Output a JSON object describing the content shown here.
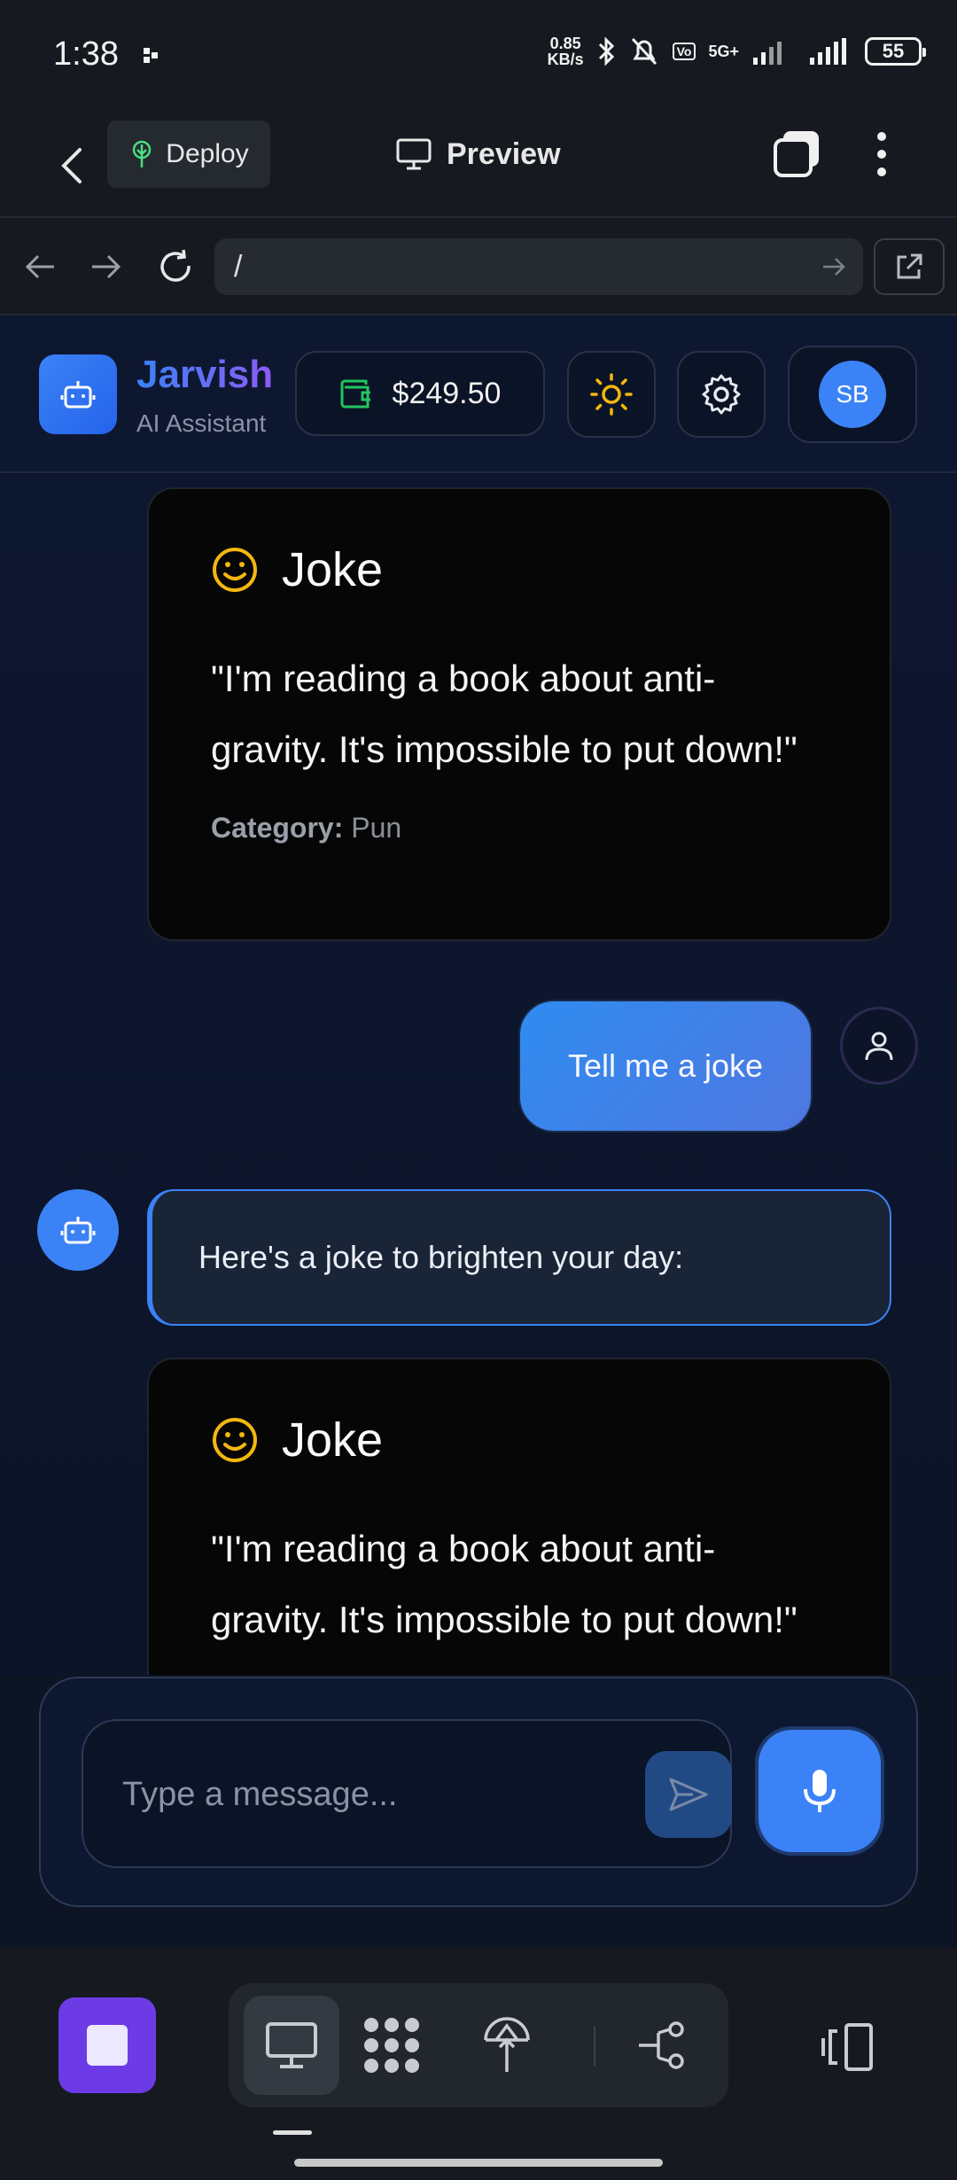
{
  "status_bar": {
    "time": "1:38",
    "speed_value": "0.85",
    "speed_unit": "KB/s",
    "vo_label": "Vo",
    "network": "5G+",
    "battery": "55"
  },
  "header": {
    "deploy_label": "Deploy",
    "preview_label": "Preview"
  },
  "browser": {
    "url": "/"
  },
  "app": {
    "name": "Jarvish",
    "subtitle": "AI Assistant",
    "balance": "$249.50",
    "user_initials": "SB"
  },
  "messages": {
    "joke_card_1": {
      "title": "Joke",
      "text": "\"I'm reading a book about anti-gravity. It's impossible to put down!\"",
      "category_label": "Category:",
      "category_value": "Pun"
    },
    "user_message": "Tell me a joke",
    "bot_message": "Here's a joke to brighten your day:",
    "joke_card_2": {
      "title": "Joke",
      "text": "\"I'm reading a book about anti-gravity. It's impossible to put down!\""
    }
  },
  "composer": {
    "placeholder": "Type a message..."
  },
  "colors": {
    "accent": "#3b82f6",
    "brand_gradient_end": "#8b5cf6",
    "stop_button": "#6d3be6",
    "joke_icon": "#f5b70f",
    "wallet_icon": "#22c55e"
  },
  "icons": {
    "back": "chevron-left-icon",
    "deploy": "rocket-icon",
    "preview": "monitor-icon",
    "wallet": "wallet-icon",
    "theme": "sun-icon",
    "settings": "gear-icon",
    "joke": "smiley-icon",
    "bot": "robot-icon",
    "user": "user-icon",
    "send": "send-icon",
    "mic": "microphone-icon"
  }
}
